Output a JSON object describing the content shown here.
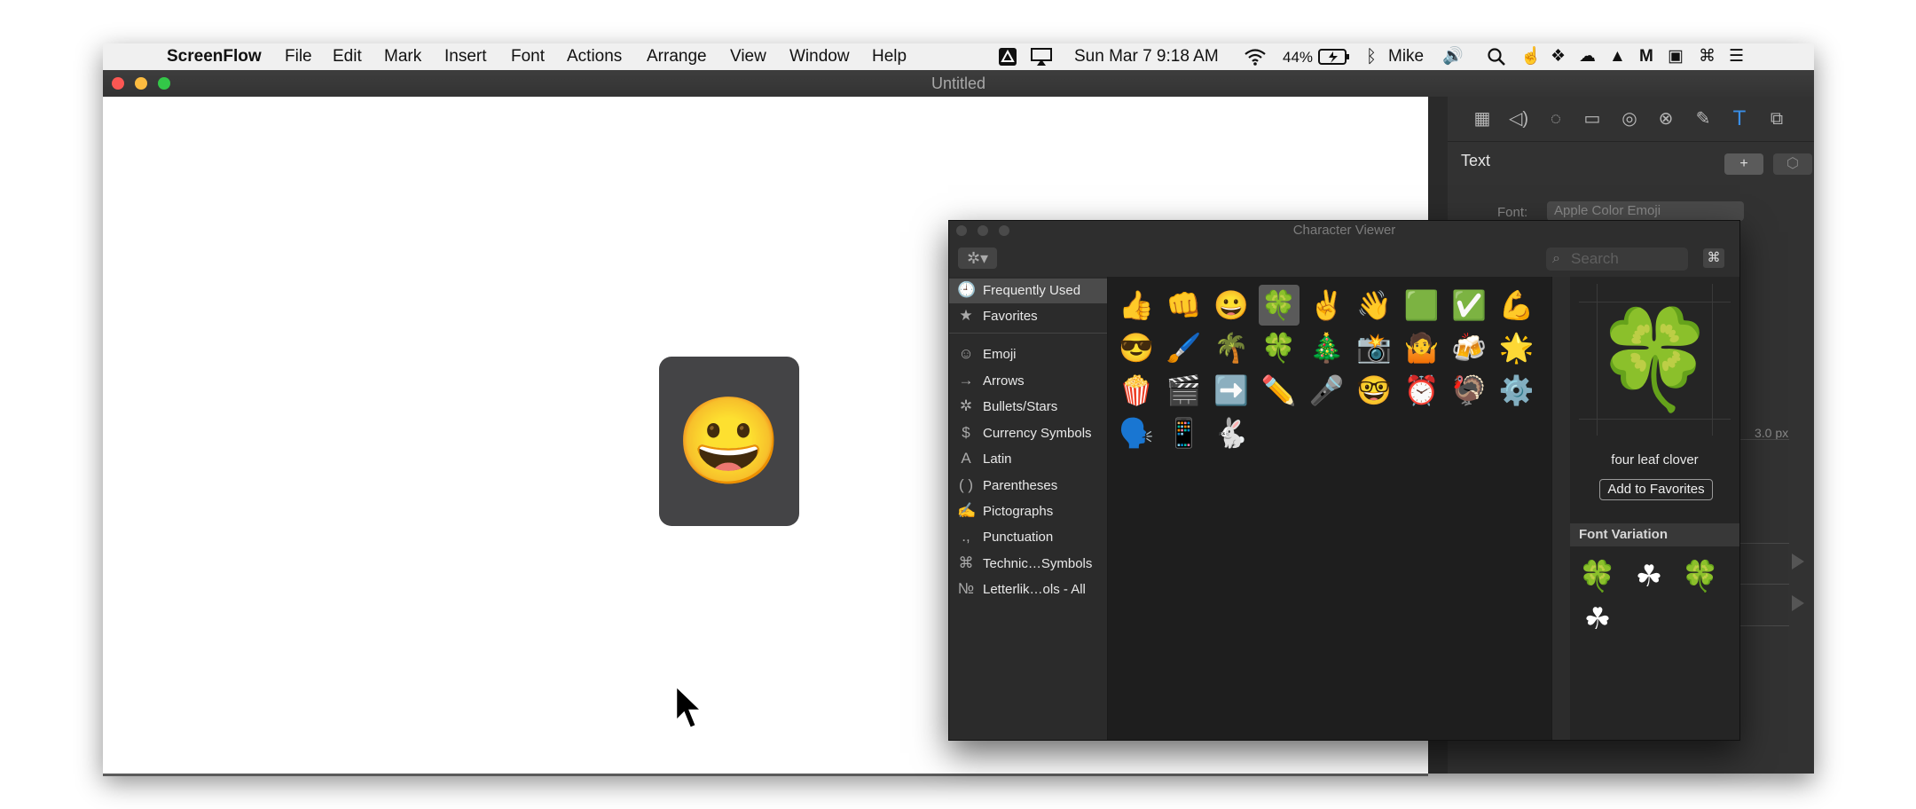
{
  "menubar": {
    "app_name": "ScreenFlow",
    "menus": [
      "File",
      "Edit",
      "Mark",
      "Insert",
      "Font",
      "Actions",
      "Arrange",
      "View",
      "Window",
      "Help"
    ],
    "datetime": "Sun Mar 7  9:18 AM",
    "battery": "44%",
    "user": "Mike"
  },
  "window": {
    "title": "Untitled"
  },
  "canvas": {
    "emoji": "😀"
  },
  "inspector": {
    "section_title": "Text",
    "add_label": "+",
    "font_label": "Font:",
    "font_value": "Apple Color Emoji",
    "size_value": "3.0 px"
  },
  "character_viewer": {
    "title": "Character Viewer",
    "search_placeholder": "Search",
    "categories": [
      {
        "icon": "🕘",
        "label": "Frequently Used"
      },
      {
        "icon": "★",
        "label": "Favorites"
      },
      {
        "icon": "☺",
        "label": "Emoji"
      },
      {
        "icon": "→",
        "label": "Arrows"
      },
      {
        "icon": "✲",
        "label": "Bullets/Stars"
      },
      {
        "icon": "$",
        "label": "Currency Symbols"
      },
      {
        "icon": "A",
        "label": "Latin"
      },
      {
        "icon": "( )",
        "label": "Parentheses"
      },
      {
        "icon": "✍",
        "label": "Pictographs"
      },
      {
        "icon": ".,",
        "label": "Punctuation"
      },
      {
        "icon": "⌘",
        "label": "Technic…Symbols"
      },
      {
        "icon": "№",
        "label": "Letterlik…ols - All"
      }
    ],
    "emojis": [
      [
        "👍",
        "👊",
        "😀",
        "🍀",
        "✌️",
        "👋",
        "🟩",
        "✅",
        "💪"
      ],
      [
        "😎",
        "🖌️",
        "🌴",
        "🍀",
        "🎄",
        "📸",
        "🤷",
        "🍻",
        "🌟"
      ],
      [
        "🍿",
        "🎬",
        "➡️",
        "✏️",
        "🎤",
        "🤓",
        "⏰",
        "🦃",
        "⚙️"
      ],
      [
        "🗣️",
        "📱",
        "🐇"
      ]
    ],
    "selected_emoji": "🍀",
    "selected_name": "four leaf clover",
    "add_favorites_label": "Add to Favorites",
    "font_variation_title": "Font Variation",
    "variations": [
      "🍀",
      "☘",
      "🍀",
      "☘"
    ]
  }
}
